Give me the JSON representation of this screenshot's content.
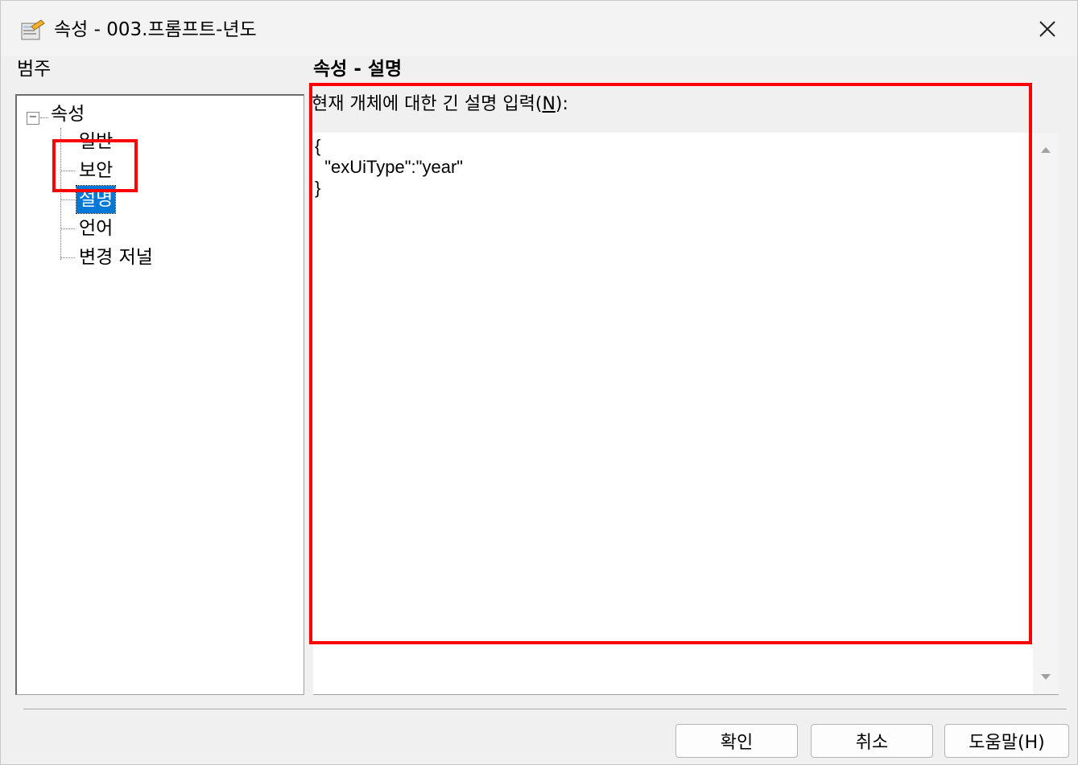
{
  "window": {
    "title": "속성 - 003.프롬프트-년도"
  },
  "labels": {
    "category": "범주",
    "property_header": "속성 - 설명"
  },
  "tree": {
    "root": "속성",
    "items": [
      {
        "label": "일반"
      },
      {
        "label": "보안"
      },
      {
        "label": "설명",
        "selected": true
      },
      {
        "label": "언어"
      },
      {
        "label": "변경 저널"
      }
    ]
  },
  "description": {
    "prompt": "현재 개체에 대한 긴 설명 입력(N):",
    "prompt_prefix": "현재 개체에 대한 긴 설명 입력(",
    "prompt_key": "N",
    "prompt_suffix": "):",
    "value": "{\n  \"exUiType\":\"year\"\n}"
  },
  "buttons": {
    "ok": "확인",
    "cancel": "취소",
    "help": "도움말(H)"
  },
  "colors": {
    "highlight": "#ff0000",
    "selection": "#0078d7"
  }
}
